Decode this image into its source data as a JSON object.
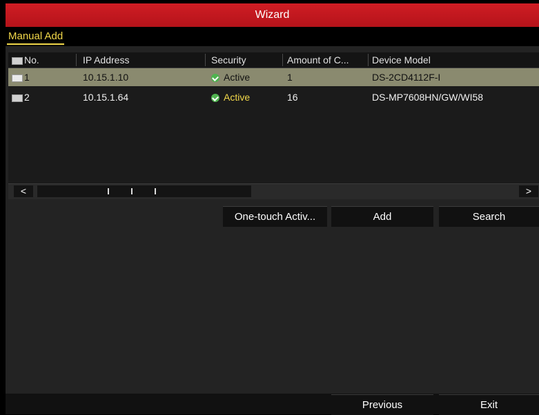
{
  "window": {
    "title": "Wizard"
  },
  "tabs": [
    {
      "label": "Manual Add",
      "active": true
    }
  ],
  "table": {
    "columns": [
      "No.",
      "IP Address",
      "Security",
      "Amount of C...",
      "Device Model"
    ],
    "rows": [
      {
        "no": "1",
        "ip": "10.15.1.10",
        "security": "Active",
        "amount": "1",
        "model": "DS-2CD4112F-I",
        "selected": true
      },
      {
        "no": "2",
        "ip": "10.15.1.64",
        "security": "Active",
        "amount": "16",
        "model": "DS-MP7608HN/GW/WI58",
        "selected": false
      }
    ]
  },
  "scrollbar": {
    "left_arrow": "<",
    "right_arrow": ">"
  },
  "actions": {
    "one_touch": "One-touch Activ...",
    "add": "Add",
    "search": "Search"
  },
  "footer": {
    "previous": "Previous",
    "exit": "Exit"
  },
  "colors": {
    "title_bar": "#c1171e",
    "accent_yellow": "#f2d84a",
    "selected_row": "#8a8a6f",
    "status_ok": "#4fb24f"
  }
}
